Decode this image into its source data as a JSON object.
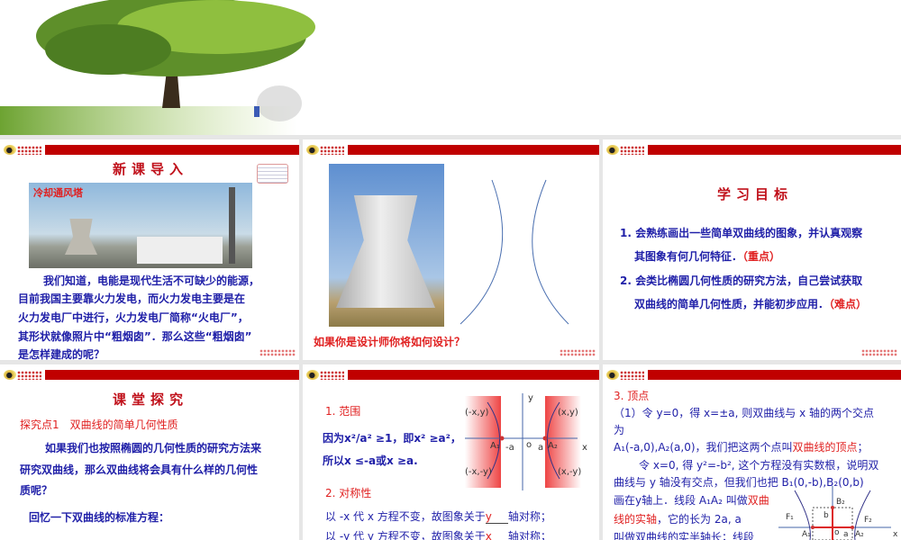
{
  "slides": {
    "intro": {
      "title": "新课导入",
      "photo_label": "冷却通风塔",
      "lines": [
        "我们知道，电能是现代生活不可缺少的能源，",
        "目前我国主要靠火力发电，而火力发电主要是在",
        "火力发电厂中进行，火力发电厂简称“火电厂”，",
        "其形状就像照片中“粗烟囱”．那么这些“粗烟囱”",
        "是怎样建成的呢？"
      ]
    },
    "tower": {
      "question": "如果你是设计师你将如何设计？"
    },
    "goals": {
      "title": "学习目标",
      "items": [
        {
          "l1": "1. 会熟练画出一些简单双曲线的图象，并认真观察",
          "l2": "其图象有何几何特征．",
          "tag": "（重点）"
        },
        {
          "l1": "2. 会类比椭圆几何性质的研究方法，自己尝试获取",
          "l2": "双曲线的简单几何性质，并能初步应用．",
          "tag": "（难点）"
        }
      ]
    },
    "explore": {
      "title": "课堂探究",
      "subtitle": "探究点1　双曲线的简单几何性质",
      "lines": [
        "如果我们也按照椭圆的几何性质的研究方法来",
        "研究双曲线，那么双曲线将会具有什么样的几何性",
        "质呢？"
      ],
      "recall": "回忆一下双曲线的标准方程："
    },
    "range": {
      "h1": "1. 范围",
      "l1": "因为x²/a² ≥1，即x² ≥a²，",
      "l2": "所以x ≤-a或x ≥a.",
      "h2": "2. 对称性",
      "s1a": "以 -x 代 x 方程不变，故图象关于",
      "s1b": "y",
      "s1c": "轴对称；",
      "s2a": "以 -y 代 y 方程不变，故图象关于",
      "s2b": "x",
      "s2c": "轴对称；",
      "diagram": {
        "p1": "(-x,y)",
        "p2": "(x,y)",
        "p3": "(-x,-y)",
        "p4": "(x,-y)",
        "a1": "A₁",
        "a2": "A₂",
        "neg_a": "-a",
        "o": "o",
        "a": "a",
        "x": "x",
        "y": "y"
      }
    },
    "vertex": {
      "h": "3. 顶点",
      "l1": "（1）令 y=0，得 x=±a, 则双曲线与 x 轴的两个交点",
      "l2": "为",
      "l3a": "A₁(-a,0),A₂(a,0)，我们把这两个点叫",
      "l3b": "双曲线的顶点",
      "l3c": "；",
      "l4": "令 x=0, 得 y²=-b², 这个方程没有实数根，说明双",
      "l5": "曲线与 y 轴没有交点，但我们也把 B₁(0,-b),B₂(0,b)",
      "l6a": "画在y轴上．线段 A₁A₂ 叫做",
      "l6b": "双曲",
      "l7a": "线的实轴",
      "l7b": "，它的长为 2a, a",
      "l8": "叫做双曲线的实半轴长；线段",
      "diagram": {
        "b2": "B₂",
        "b": "b",
        "f1": "F₁",
        "f2": "F₂",
        "o": "o",
        "a": "a",
        "a1": "A₁",
        "a2": "A₂",
        "x": "x"
      }
    }
  },
  "colors": {
    "bar": "#c00000",
    "text": "#1f1fa8",
    "accent": "#e02020"
  }
}
